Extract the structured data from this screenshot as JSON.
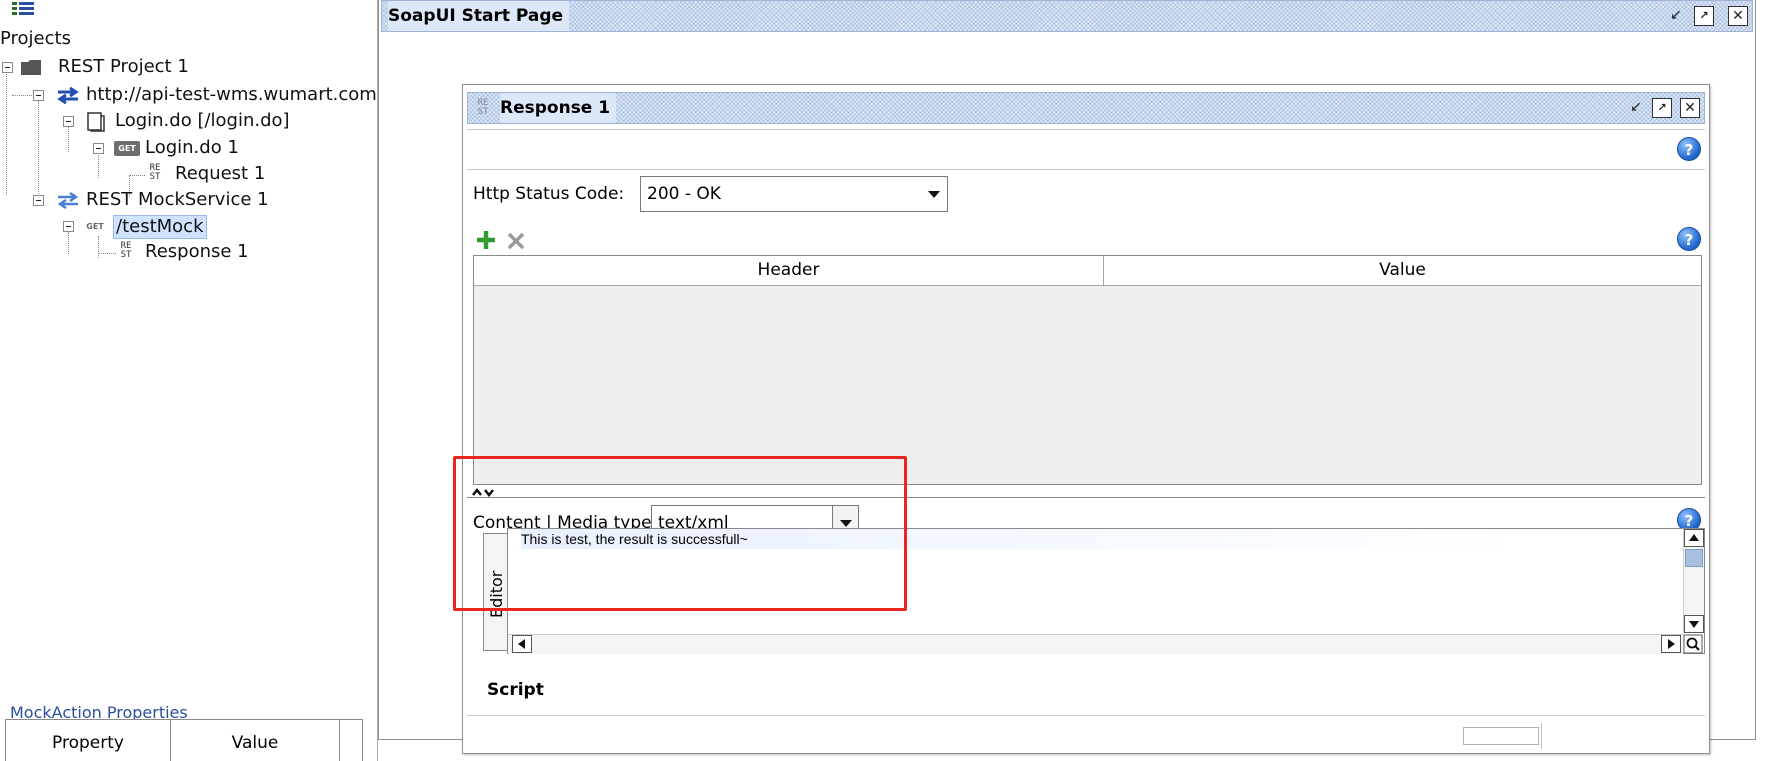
{
  "navigator": {
    "root_label": "Projects",
    "items": [
      {
        "label": "REST Project 1"
      },
      {
        "label": "http://api-test-wms.wumart.com"
      },
      {
        "label": "Login.do [/login.do]"
      },
      {
        "label": "Login.do 1",
        "badge": "GET"
      },
      {
        "label": "Request 1",
        "badge": "RE ST"
      },
      {
        "label": "REST MockService 1"
      },
      {
        "label": "/testMock",
        "badge": "GET"
      },
      {
        "label": "Response 1",
        "badge": "RE ST"
      }
    ],
    "properties": {
      "title": "MockAction Properties",
      "columns": [
        "Property",
        "Value"
      ]
    }
  },
  "start_page": {
    "title": "SoapUI Start Page"
  },
  "response_window": {
    "icon_text": "RE ST",
    "title": "Response 1",
    "http_status_label": "Http Status Code:",
    "http_status_value": "200 - OK",
    "headers_columns": [
      "Header",
      "Value"
    ],
    "content_label": "Content | Media type:",
    "media_type_value": "text/xml",
    "editor_tab_label": "Editor",
    "editor_text": "This is test, the result is successfull~",
    "script_label": "Script"
  },
  "colors": {
    "highlight": "#e8261e",
    "selection": "#cfe2ff",
    "add_icon": "#2e9e2e",
    "help_icon": "#1d63c9"
  }
}
